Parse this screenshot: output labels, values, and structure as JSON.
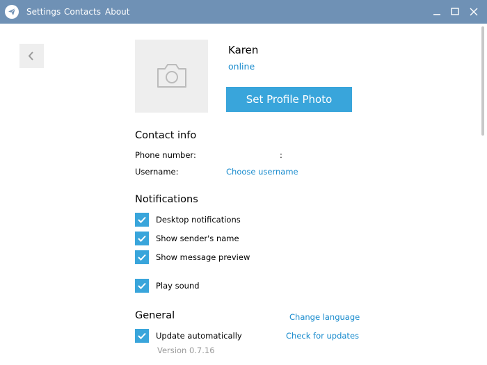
{
  "menu": {
    "settings": "Settings",
    "contacts": "Contacts",
    "about": "About"
  },
  "icons": {
    "app": "telegram-plane-icon",
    "back": "chevron-left-icon",
    "camera": "camera-icon",
    "minimize": "minimize-icon",
    "maximize": "maximize-icon",
    "close": "close-icon",
    "check": "check-icon"
  },
  "colors": {
    "titlebar": "#6f91b5",
    "accent": "#39a5db",
    "link": "#168acd"
  },
  "profile": {
    "name": "Karen",
    "status": "online",
    "set_photo_label": "Set Profile Photo"
  },
  "contact_info": {
    "title": "Contact info",
    "phone_label": "Phone number:",
    "phone_value": ":",
    "username_label": "Username:",
    "username_link": "Choose username"
  },
  "notifications": {
    "title": "Notifications",
    "items": [
      {
        "label": "Desktop notifications",
        "checked": true
      },
      {
        "label": "Show sender's name",
        "checked": true
      },
      {
        "label": "Show message preview",
        "checked": true
      },
      {
        "label": "Play sound",
        "checked": true
      }
    ]
  },
  "general": {
    "title": "General",
    "change_language": "Change language",
    "update_label": "Update automatically",
    "update_checked": true,
    "check_updates": "Check for updates",
    "version": "Version 0.7.16"
  }
}
